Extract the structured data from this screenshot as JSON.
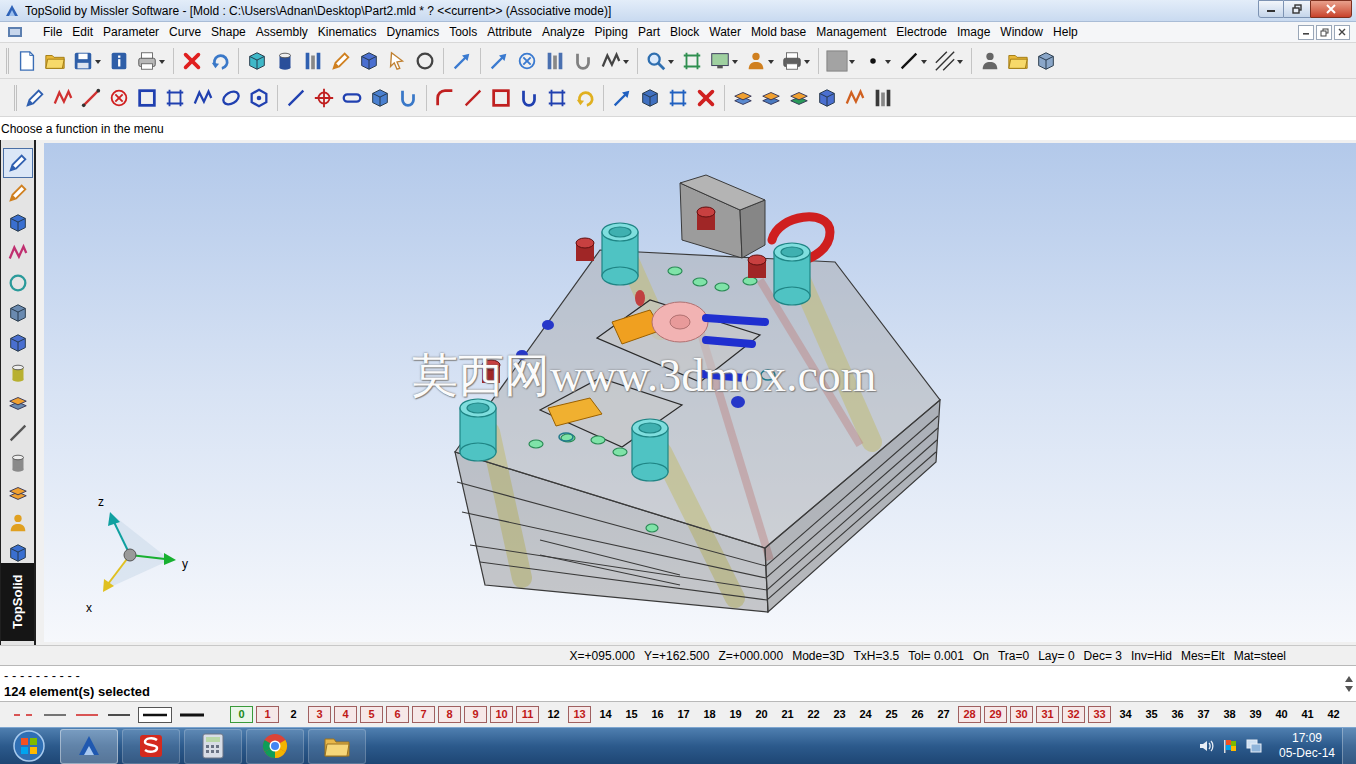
{
  "window": {
    "title": "TopSolid by Missler Software - [Mold : C:\\Users\\Adnan\\Desktop\\Part2.mld * ?  <<current>> (Associative mode)]"
  },
  "menu": [
    "File",
    "Edit",
    "Parameter",
    "Curve",
    "Shape",
    "Assembly",
    "Kinematics",
    "Dynamics",
    "Tools",
    "Attribute",
    "Analyze",
    "Piping",
    "Part",
    "Block",
    "Water",
    "Mold base",
    "Management",
    "Electrode",
    "Image",
    "Window",
    "Help"
  ],
  "prompt": "Choose a function in the menu",
  "side_label": "TopSolid",
  "viewport": {
    "watermark": "莫西网www.3dmox.com",
    "axes": {
      "x": "x",
      "y": "y",
      "z": "z"
    }
  },
  "status_bar": [
    "X=+095.000",
    "Y=+162.500",
    "Z=+000.000",
    "Mode=3D",
    "TxH=3.5",
    "Tol= 0.001",
    "On",
    "Tra=0",
    "Lay= 0",
    "Dec= 3",
    "Inv=Hid",
    "Mes=Elt",
    "Mat=steel"
  ],
  "command": {
    "lines": [
      "- - - - - - - - - -"
    ],
    "message": "124 element(s) selected"
  },
  "layers": [
    {
      "label": "0",
      "kind": "current"
    },
    {
      "label": "1",
      "kind": "used"
    },
    {
      "label": "2",
      "kind": "empty"
    },
    {
      "label": "3",
      "kind": "used"
    },
    {
      "label": "4",
      "kind": "used"
    },
    {
      "label": "5",
      "kind": "used"
    },
    {
      "label": "6",
      "kind": "used"
    },
    {
      "label": "7",
      "kind": "used"
    },
    {
      "label": "8",
      "kind": "used"
    },
    {
      "label": "9",
      "kind": "used"
    },
    {
      "label": "10",
      "kind": "used"
    },
    {
      "label": "11",
      "kind": "used"
    },
    {
      "label": "12",
      "kind": "empty"
    },
    {
      "label": "13",
      "kind": "used"
    },
    {
      "label": "14",
      "kind": "empty"
    },
    {
      "label": "15",
      "kind": "empty"
    },
    {
      "label": "16",
      "kind": "empty"
    },
    {
      "label": "17",
      "kind": "empty"
    },
    {
      "label": "18",
      "kind": "empty"
    },
    {
      "label": "19",
      "kind": "empty"
    },
    {
      "label": "20",
      "kind": "empty"
    },
    {
      "label": "21",
      "kind": "empty"
    },
    {
      "label": "22",
      "kind": "empty"
    },
    {
      "label": "23",
      "kind": "empty"
    },
    {
      "label": "24",
      "kind": "empty"
    },
    {
      "label": "25",
      "kind": "empty"
    },
    {
      "label": "26",
      "kind": "empty"
    },
    {
      "label": "27",
      "kind": "empty"
    },
    {
      "label": "28",
      "kind": "used"
    },
    {
      "label": "29",
      "kind": "used"
    },
    {
      "label": "30",
      "kind": "used"
    },
    {
      "label": "31",
      "kind": "used"
    },
    {
      "label": "32",
      "kind": "used"
    },
    {
      "label": "33",
      "kind": "used"
    },
    {
      "label": "34",
      "kind": "empty"
    },
    {
      "label": "35",
      "kind": "empty"
    },
    {
      "label": "36",
      "kind": "empty"
    },
    {
      "label": "37",
      "kind": "empty"
    },
    {
      "label": "38",
      "kind": "empty"
    },
    {
      "label": "39",
      "kind": "empty"
    },
    {
      "label": "40",
      "kind": "empty"
    },
    {
      "label": "41",
      "kind": "empty"
    },
    {
      "label": "42",
      "kind": "empty"
    }
  ],
  "clock": {
    "time": "17:09",
    "date": "05-Dec-14"
  }
}
